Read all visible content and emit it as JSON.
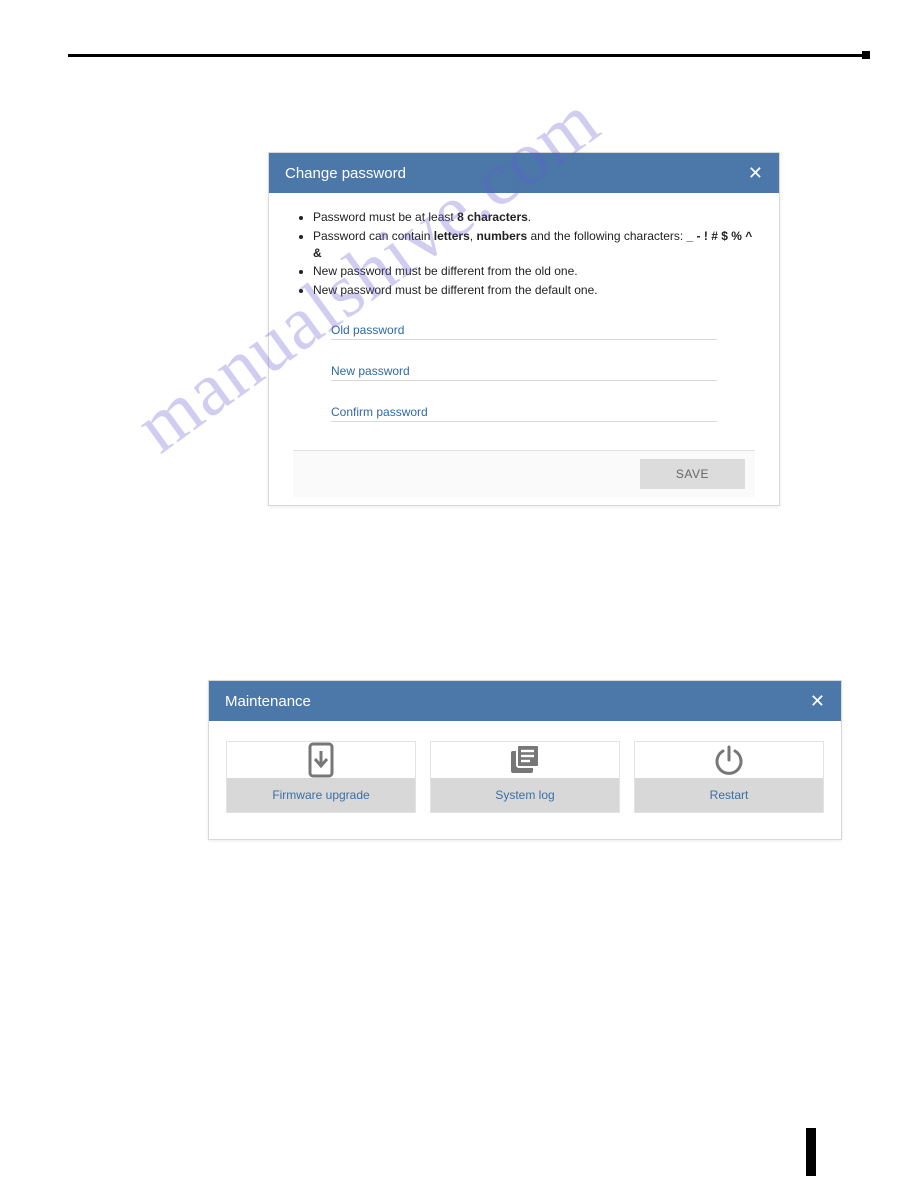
{
  "watermark": "manualshive.com",
  "password_dialog": {
    "title": "Change password",
    "rules": {
      "r1_pre": "Password must be at least ",
      "r1_strong": "8 characters",
      "r1_post": ".",
      "r2_pre": "Password can contain ",
      "r2_s1": "letters",
      "r2_mid": ", ",
      "r2_s2": "numbers",
      "r2_text": " and the following characters: ",
      "r2_s3": "_ - ! # $ % ^ &",
      "r3": "New password must be different from the old one.",
      "r4": "New password must be different from the default one."
    },
    "labels": {
      "old": "Old password",
      "new": "New password",
      "confirm": "Confirm password"
    },
    "save": "SAVE"
  },
  "maintenance_dialog": {
    "title": "Maintenance",
    "cards": {
      "firmware": "Firmware upgrade",
      "syslog": "System log",
      "restart": "Restart"
    }
  }
}
